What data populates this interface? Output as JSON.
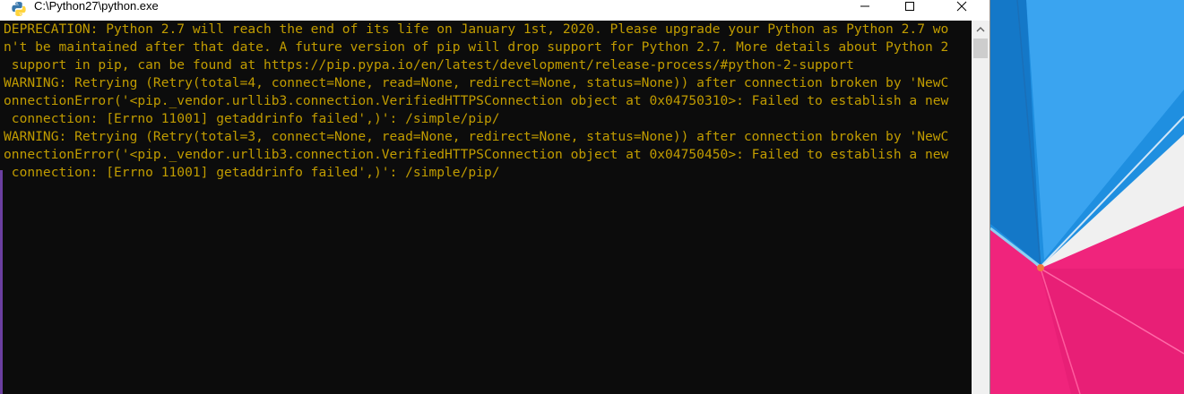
{
  "window": {
    "title": "C:\\Python27\\python.exe",
    "icon": "python-icon",
    "controls": {
      "minimize_icon": "minimize-icon",
      "maximize_icon": "maximize-icon",
      "close_icon": "close-icon"
    }
  },
  "console": {
    "text_color": "#c19c00",
    "background_color": "#0c0c0c",
    "lines": [
      "DEPRECATION: Python 2.7 will reach the end of its life on January 1st, 2020. Please upgrade your Python as Python 2.7 wo",
      "n't be maintained after that date. A future version of pip will drop support for Python 2.7. More details about Python 2",
      " support in pip, can be found at https://pip.pypa.io/en/latest/development/release-process/#python-2-support",
      "WARNING: Retrying (Retry(total=4, connect=None, read=None, redirect=None, status=None)) after connection broken by 'NewC",
      "onnectionError('<pip._vendor.urllib3.connection.VerifiedHTTPSConnection object at 0x04750310>: Failed to establish a new",
      " connection: [Errno 11001] getaddrinfo failed',)': /simple/pip/",
      "WARNING: Retrying (Retry(total=3, connect=None, read=None, redirect=None, status=None)) after connection broken by 'NewC",
      "onnectionError('<pip._vendor.urllib3.connection.VerifiedHTTPSConnection object at 0x04750450>: Failed to establish a new",
      " connection: [Errno 11001] getaddrinfo failed',)': /simple/pip/"
    ]
  },
  "scrollbar": {
    "up_icon": "chevron-up-icon"
  },
  "wallpaper": {
    "colors": {
      "umbrella_blue": "#1f8fe0",
      "umbrella_pink": "#f0247c"
    }
  }
}
